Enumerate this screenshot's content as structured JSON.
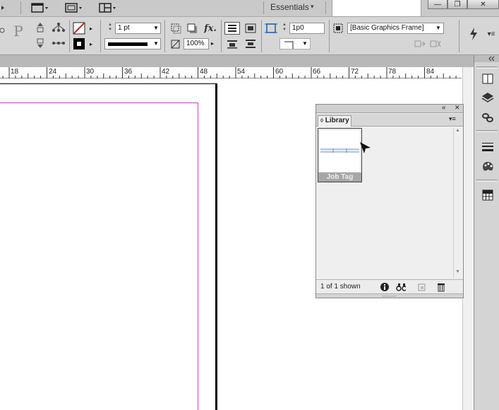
{
  "appbar": {
    "workspace_label": "Essentials",
    "workspace_arrow": "▾",
    "icons": [
      "view-options-icon",
      "screen-mode-icon",
      "arrange-documents-icon"
    ],
    "window_buttons": {
      "minimize": "—",
      "restore": "❐",
      "close": "✕"
    }
  },
  "control_panel": {
    "stroke_weight": "1 pt",
    "opacity": "100%",
    "offset": "1p0",
    "object_style": "[Basic Graphics Frame]",
    "fx_label": "fx.",
    "paragraph_glyph": "P"
  },
  "ruler": {
    "labels": [
      "18",
      "24",
      "30",
      "36",
      "42",
      "48",
      "54",
      "60",
      "66",
      "72",
      "78",
      "84"
    ]
  },
  "library_panel": {
    "title": "Library",
    "item_label": "Job Tag",
    "footer_count": "1 of 1 shown",
    "collapse_glyph": "«",
    "close_glyph": "✕",
    "menu_glyph": "▾≡"
  },
  "dock": {
    "icons": [
      "pages-icon",
      "layers-icon",
      "links-icon",
      "stroke-icon",
      "swatches-icon",
      "table-icon"
    ]
  },
  "colors": {
    "margin_guide": "#c63dc6",
    "stroke_red": "#c0272d",
    "chrome_bg": "#d6d6d6"
  }
}
